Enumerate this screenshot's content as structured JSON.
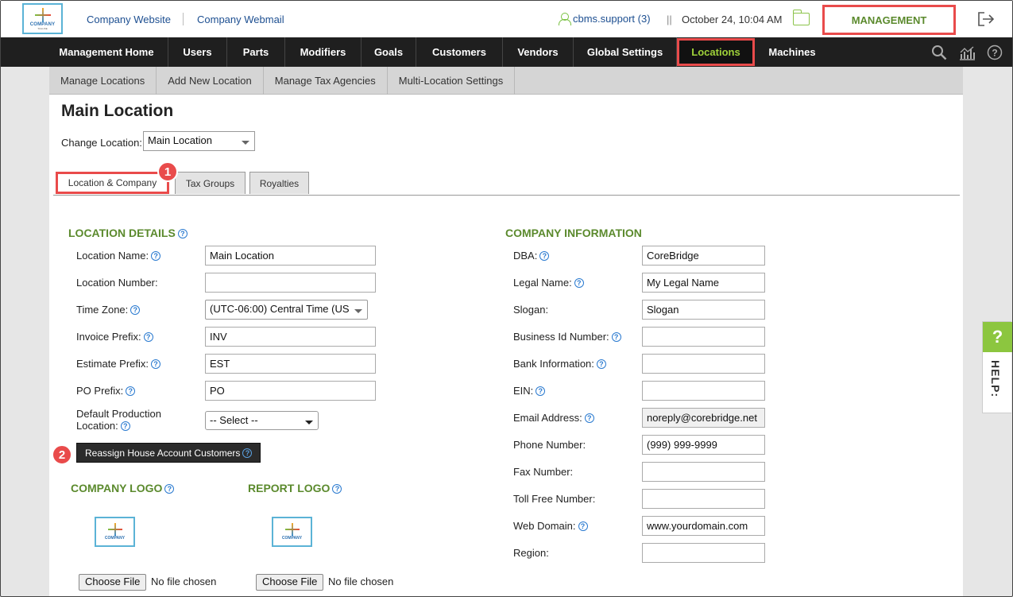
{
  "header": {
    "logo_text": "COMPANY",
    "logo_sub": "TAGLINE",
    "company_website": "Company Website",
    "company_webmail": "Company Webmail",
    "user": "cbms.support (3)",
    "separator": "||",
    "datetime": "October 24, 10:04 AM",
    "management": "MANAGEMENT"
  },
  "nav": {
    "items": [
      "Management Home",
      "Users",
      "Parts",
      "Modifiers",
      "Goals",
      "Customers",
      "Vendors",
      "Global Settings",
      "Locations",
      "Machines"
    ],
    "active": "Locations"
  },
  "subnav": {
    "items": [
      "Manage Locations",
      "Add New Location",
      "Manage Tax Agencies",
      "Multi-Location Settings"
    ]
  },
  "page": {
    "title": "Main Location",
    "change_location_label": "Change Location:",
    "change_location_value": "Main Location"
  },
  "tabs": [
    "Location & Company",
    "Tax Groups",
    "Royalties"
  ],
  "badges": [
    "1",
    "2"
  ],
  "location_details": {
    "heading": "LOCATION DETAILS",
    "fields": [
      {
        "label": "Location Name:",
        "value": "Main Location",
        "help": true
      },
      {
        "label": "Location Number:",
        "value": "",
        "help": false
      },
      {
        "label": "Time Zone:",
        "value": "(UTC-06:00) Central Time (US",
        "help": true
      },
      {
        "label": "Invoice Prefix:",
        "value": "INV",
        "help": true
      },
      {
        "label": "Estimate Prefix:",
        "value": "EST",
        "help": true
      },
      {
        "label": "PO Prefix:",
        "value": "PO",
        "help": true
      }
    ],
    "default_production_label_1": "Default Production",
    "default_production_label_2": "Location:",
    "default_production_value": "-- Select --",
    "reassign_button": "Reassign House Account Customers"
  },
  "logos": {
    "company_logo": "COMPANY LOGO",
    "report_logo": "REPORT LOGO",
    "choose_file": "Choose File",
    "no_file": "No file chosen"
  },
  "company_information": {
    "heading": "COMPANY INFORMATION",
    "fields": [
      {
        "label": "DBA:",
        "value": "CoreBridge",
        "help": true
      },
      {
        "label": "Legal Name:",
        "value": "My Legal Name",
        "help": true
      },
      {
        "label": "Slogan:",
        "value": "Slogan",
        "help": false
      },
      {
        "label": "Business Id Number:",
        "value": "",
        "help": true
      },
      {
        "label": "Bank Information:",
        "value": "",
        "help": true
      },
      {
        "label": "EIN:",
        "value": "",
        "help": true
      },
      {
        "label": "Email Address:",
        "value": "noreply@corebridge.net",
        "help": true
      },
      {
        "label": "Phone Number:",
        "value": "(999) 999-9999",
        "help": false
      },
      {
        "label": "Fax Number:",
        "value": "",
        "help": false
      },
      {
        "label": "Toll Free Number:",
        "value": "",
        "help": false
      },
      {
        "label": "Web Domain:",
        "value": "www.yourdomain.com",
        "help": true
      },
      {
        "label": "Region:",
        "value": "",
        "help": false
      }
    ]
  },
  "help_tab": {
    "mark": "?",
    "text": "HELP:"
  },
  "colors": {
    "accent_green": "#5b8a2d",
    "highlight_red": "#e94b4b",
    "nav_bg": "#1f1f1f"
  }
}
